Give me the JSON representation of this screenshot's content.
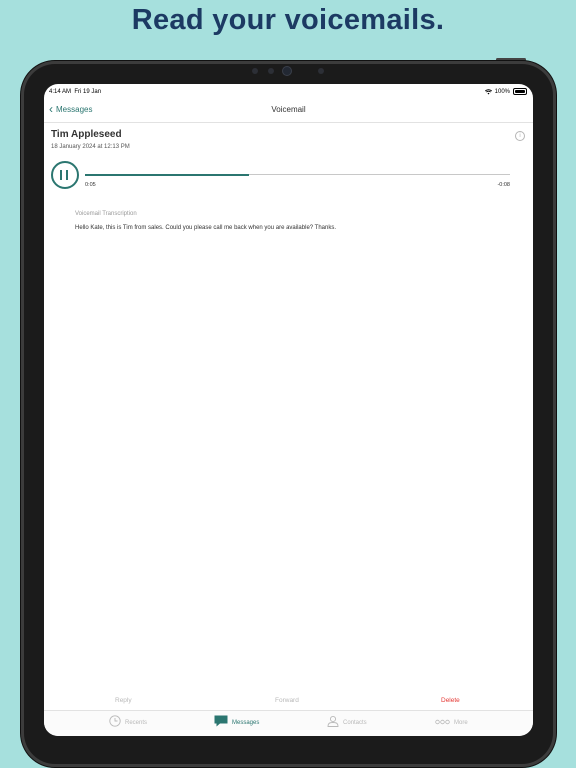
{
  "headline": "Read your voicemails.",
  "status_bar": {
    "time": "4:14 AM",
    "date": "Fri 19 Jan",
    "battery": "100%"
  },
  "nav": {
    "back_label": "Messages",
    "title": "Voicemail"
  },
  "voicemail": {
    "caller": "Tim Appleseed",
    "date": "18 January 2024 at 12:13 PM",
    "elapsed": "0:05",
    "remaining": "-0:08",
    "progress_fraction": 0.385,
    "transcription_label": "Voicemail Transcription",
    "transcription_text": "Hello Kate, this is Tim from sales. Could you please call me back when you are available? Thanks."
  },
  "actions": {
    "reply": "Reply",
    "forward": "Forward",
    "delete": "Delete"
  },
  "tabs": [
    {
      "label": "Recents",
      "icon": "clock-icon"
    },
    {
      "label": "Messages",
      "icon": "chat-bubble-icon"
    },
    {
      "label": "Contacts",
      "icon": "person-icon"
    },
    {
      "label": "More",
      "icon": "ellipsis-icon"
    }
  ],
  "colors": {
    "background": "#a6e0dd",
    "headline": "#1c3a63",
    "accent": "#2b7670",
    "delete": "#e53935",
    "inactive": "#b9b9b9"
  }
}
